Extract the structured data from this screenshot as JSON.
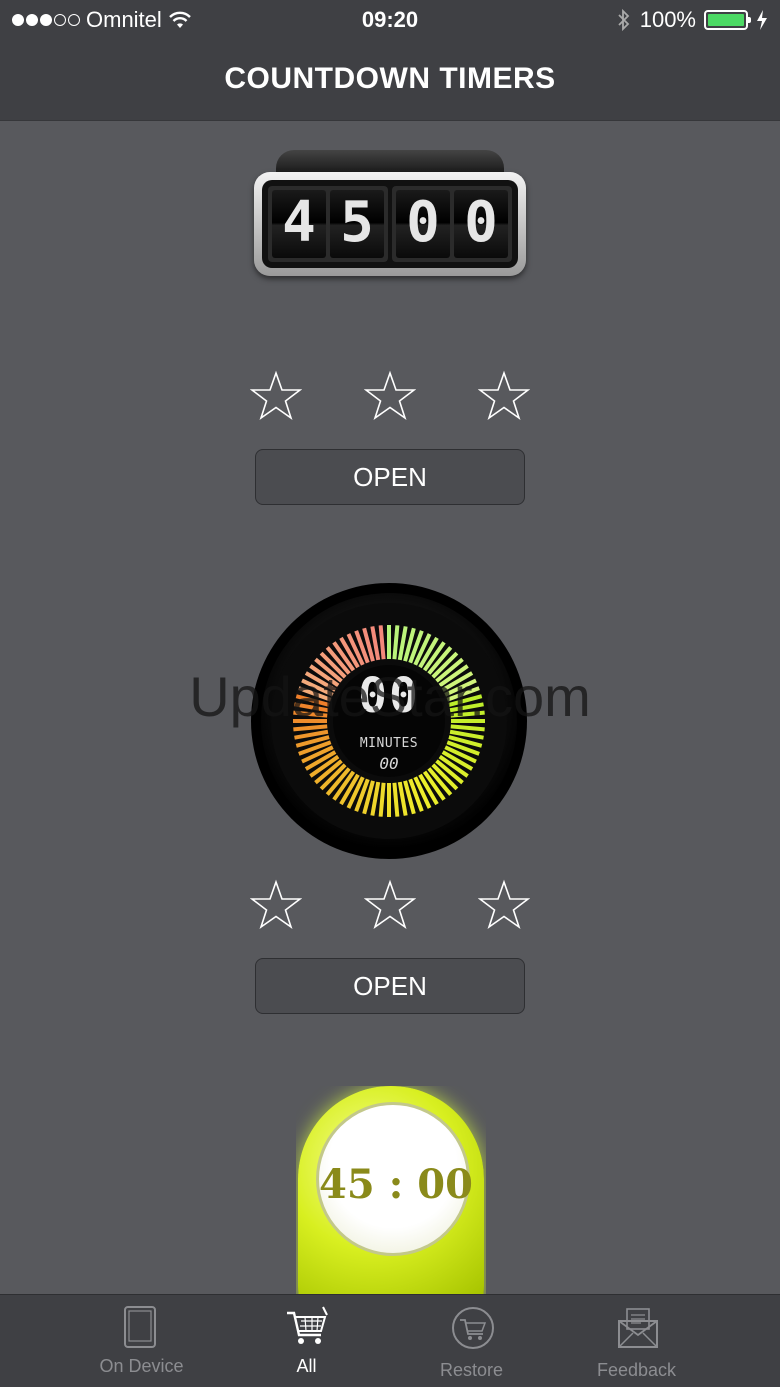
{
  "status_bar": {
    "carrier": "Omnitel",
    "time": "09:20",
    "battery_percent": "100%",
    "battery_level": 1.0,
    "signal_bars_filled": 3,
    "signal_bars_total": 5,
    "icons": [
      "wifi-icon",
      "bluetooth-icon",
      "battery-icon",
      "charging-icon"
    ]
  },
  "header": {
    "title": "COUNTDOWN TIMERS"
  },
  "timers": [
    {
      "style": "flip-clock",
      "digits": [
        "4",
        "5",
        "0",
        "0"
      ],
      "rating": {
        "filled": 0,
        "max": 3
      },
      "open_label": "OPEN"
    },
    {
      "style": "dial",
      "main_readout": "00",
      "unit_label": "MINUTES",
      "sub_readout": "00",
      "rating": {
        "filled": 0,
        "max": 3
      },
      "open_label": "OPEN"
    },
    {
      "style": "lime-pin",
      "readout": "45 : 00"
    }
  ],
  "watermark": "UpdateStar.com",
  "tab_bar": {
    "items": [
      {
        "label": "On Device",
        "icon": "tablet-icon",
        "active": false
      },
      {
        "label": "All",
        "icon": "cart-icon",
        "active": true
      },
      {
        "label": "Restore",
        "icon": "restore-cart-icon",
        "active": false
      },
      {
        "label": "Feedback",
        "icon": "envelope-icon",
        "active": false
      }
    ]
  },
  "colors": {
    "background": "#58595d",
    "bar": "#3f4044",
    "battery_green": "#4cd964",
    "lime": "#d8ef20"
  }
}
